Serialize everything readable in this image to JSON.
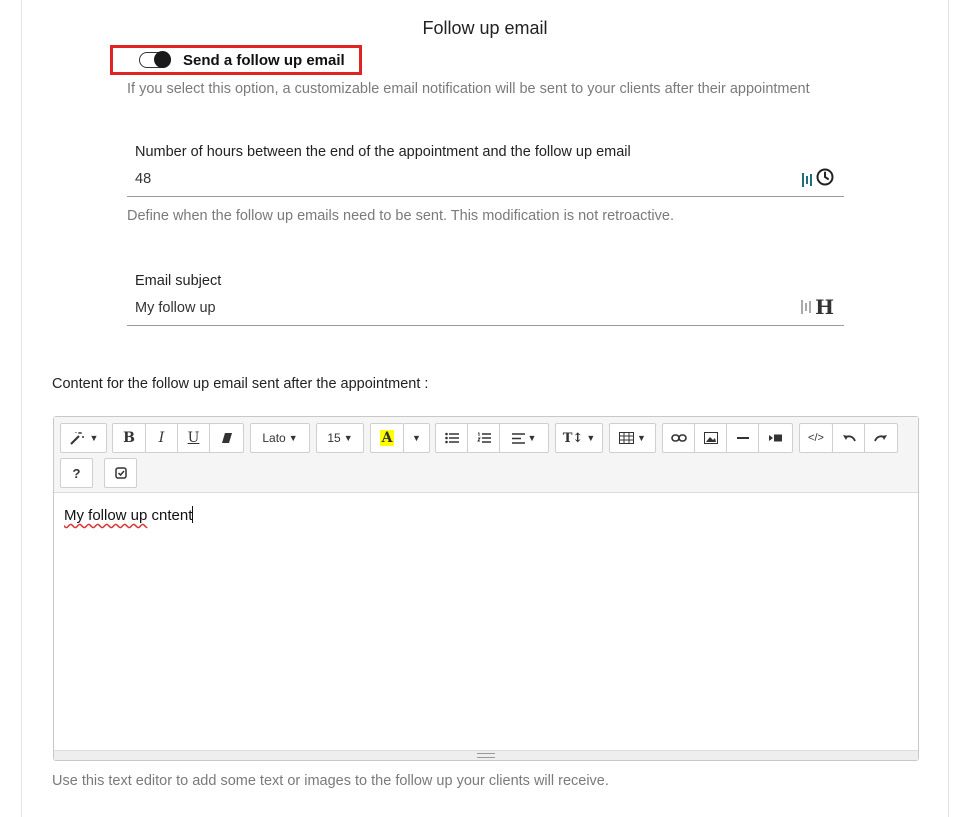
{
  "section": {
    "title": "Follow up email"
  },
  "toggle": {
    "label": "Send a follow up email",
    "checked": true
  },
  "toggle_help": "If you select this option, a customizable email notification will be sent to your clients after their appointment",
  "hours_field": {
    "label": "Number of hours between the end of the appointment and the follow up email",
    "value": "48",
    "icon": "clock-icon"
  },
  "hours_help": "Define when the follow up emails need to be sent. This modification is not retroactive.",
  "subject_field": {
    "label": "Email subject",
    "value": "My follow up",
    "icon": "heading-icon"
  },
  "content_label": "Content for the follow up email sent after the appointment :",
  "editor": {
    "toolbar": {
      "font_family": "Lato",
      "font_size": "15",
      "bold": "B",
      "italic": "I",
      "underline": "U",
      "highlight": "A",
      "code": "</>",
      "help": "?",
      "highlight_color": "#ffff00"
    },
    "content": {
      "text_spelled": "My follow up",
      "text_rest": " cntent"
    }
  },
  "editor_help": "Use this text editor to add some text or images to the follow up your clients will receive.",
  "colors": {
    "highlight_border": "#e02424",
    "accent": "#1f6f7a"
  }
}
